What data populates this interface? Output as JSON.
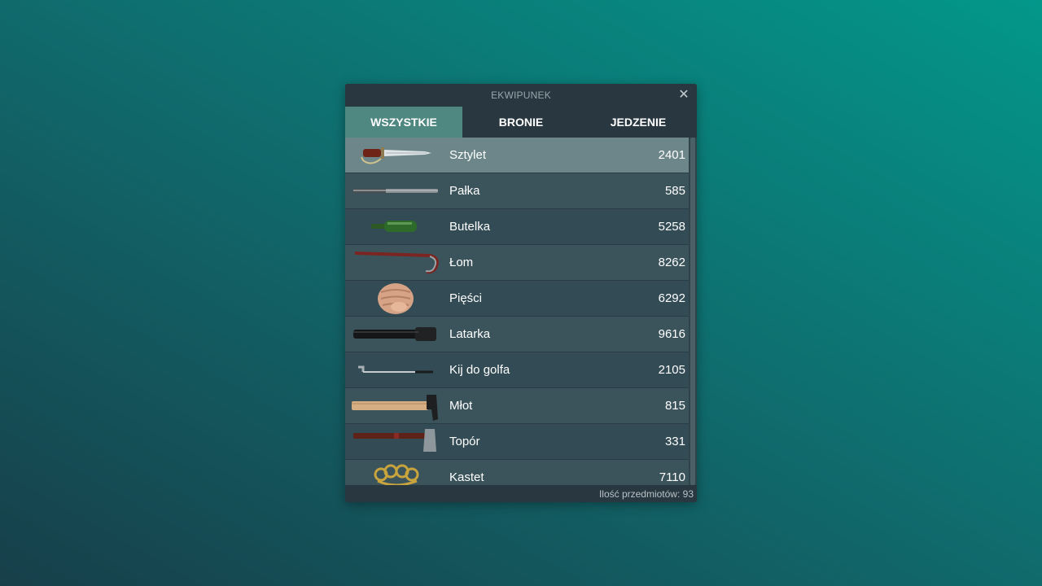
{
  "window": {
    "title": "EKWIPUNEK",
    "close_symbol": "✕"
  },
  "tabs": [
    {
      "label": "WSZYSTKIE",
      "active": true
    },
    {
      "label": "BRONIE",
      "active": false
    },
    {
      "label": "JEDZENIE",
      "active": false
    }
  ],
  "items": [
    {
      "name": "Sztylet",
      "count": "2401",
      "icon": "dagger-icon",
      "selected": true
    },
    {
      "name": "Pałka",
      "count": "585",
      "icon": "baton-icon"
    },
    {
      "name": "Butelka",
      "count": "5258",
      "icon": "bottle-icon"
    },
    {
      "name": "Łom",
      "count": "8262",
      "icon": "crowbar-icon"
    },
    {
      "name": "Pięści",
      "count": "6292",
      "icon": "fist-icon"
    },
    {
      "name": "Latarka",
      "count": "9616",
      "icon": "flashlight-icon"
    },
    {
      "name": "Kij do golfa",
      "count": "2105",
      "icon": "golf-club-icon"
    },
    {
      "name": "Młot",
      "count": "815",
      "icon": "hammer-icon"
    },
    {
      "name": "Topór",
      "count": "331",
      "icon": "axe-icon"
    },
    {
      "name": "Kastet",
      "count": "7110",
      "icon": "brass-knuckles-icon"
    }
  ],
  "footer": {
    "item_count_text": "Ilość przedmiotów: 93"
  },
  "colors": {
    "active_tab": "#4f8781",
    "selected_row": "#6d8689"
  }
}
